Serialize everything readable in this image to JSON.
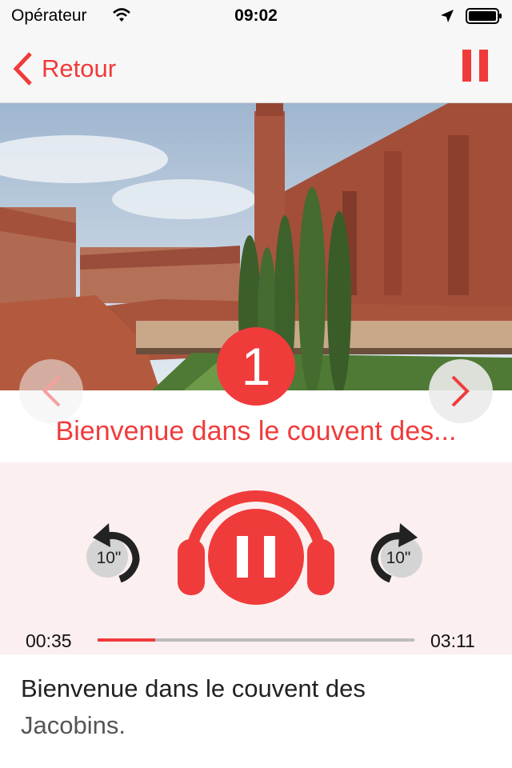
{
  "status_bar": {
    "carrier": "Opérateur",
    "time": "09:02"
  },
  "nav": {
    "back_label": "Retour"
  },
  "stop": {
    "number": "1",
    "title": "Bienvenue dans le couvent des..."
  },
  "player": {
    "skip_back_label": "10\"",
    "skip_forward_label": "10\"",
    "current_time": "00:35",
    "total_time": "03:11",
    "progress": 0.183
  },
  "description": {
    "line1": "Bienvenue dans le couvent des",
    "line2": "Jacobins."
  },
  "colors": {
    "accent": "#f03b3b",
    "player_bg": "#fbefef",
    "nav_bg": "#f7f7f7"
  }
}
